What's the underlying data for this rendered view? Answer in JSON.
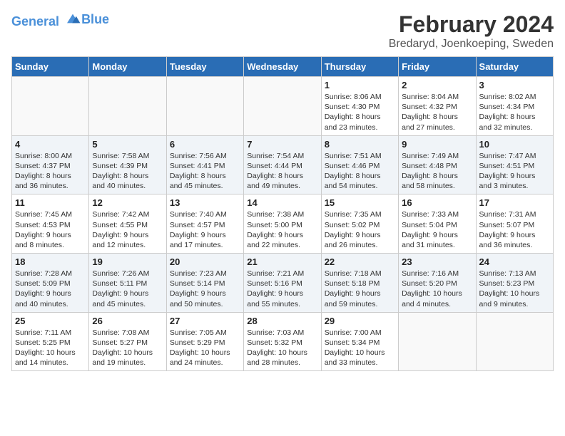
{
  "logo": {
    "line1": "General",
    "line2": "Blue"
  },
  "title": "February 2024",
  "subtitle": "Bredaryd, Joenkoeping, Sweden",
  "headers": [
    "Sunday",
    "Monday",
    "Tuesday",
    "Wednesday",
    "Thursday",
    "Friday",
    "Saturday"
  ],
  "weeks": [
    [
      {
        "day": "",
        "info": ""
      },
      {
        "day": "",
        "info": ""
      },
      {
        "day": "",
        "info": ""
      },
      {
        "day": "",
        "info": ""
      },
      {
        "day": "1",
        "info": "Sunrise: 8:06 AM\nSunset: 4:30 PM\nDaylight: 8 hours\nand 23 minutes."
      },
      {
        "day": "2",
        "info": "Sunrise: 8:04 AM\nSunset: 4:32 PM\nDaylight: 8 hours\nand 27 minutes."
      },
      {
        "day": "3",
        "info": "Sunrise: 8:02 AM\nSunset: 4:34 PM\nDaylight: 8 hours\nand 32 minutes."
      }
    ],
    [
      {
        "day": "4",
        "info": "Sunrise: 8:00 AM\nSunset: 4:37 PM\nDaylight: 8 hours\nand 36 minutes."
      },
      {
        "day": "5",
        "info": "Sunrise: 7:58 AM\nSunset: 4:39 PM\nDaylight: 8 hours\nand 40 minutes."
      },
      {
        "day": "6",
        "info": "Sunrise: 7:56 AM\nSunset: 4:41 PM\nDaylight: 8 hours\nand 45 minutes."
      },
      {
        "day": "7",
        "info": "Sunrise: 7:54 AM\nSunset: 4:44 PM\nDaylight: 8 hours\nand 49 minutes."
      },
      {
        "day": "8",
        "info": "Sunrise: 7:51 AM\nSunset: 4:46 PM\nDaylight: 8 hours\nand 54 minutes."
      },
      {
        "day": "9",
        "info": "Sunrise: 7:49 AM\nSunset: 4:48 PM\nDaylight: 8 hours\nand 58 minutes."
      },
      {
        "day": "10",
        "info": "Sunrise: 7:47 AM\nSunset: 4:51 PM\nDaylight: 9 hours\nand 3 minutes."
      }
    ],
    [
      {
        "day": "11",
        "info": "Sunrise: 7:45 AM\nSunset: 4:53 PM\nDaylight: 9 hours\nand 8 minutes."
      },
      {
        "day": "12",
        "info": "Sunrise: 7:42 AM\nSunset: 4:55 PM\nDaylight: 9 hours\nand 12 minutes."
      },
      {
        "day": "13",
        "info": "Sunrise: 7:40 AM\nSunset: 4:57 PM\nDaylight: 9 hours\nand 17 minutes."
      },
      {
        "day": "14",
        "info": "Sunrise: 7:38 AM\nSunset: 5:00 PM\nDaylight: 9 hours\nand 22 minutes."
      },
      {
        "day": "15",
        "info": "Sunrise: 7:35 AM\nSunset: 5:02 PM\nDaylight: 9 hours\nand 26 minutes."
      },
      {
        "day": "16",
        "info": "Sunrise: 7:33 AM\nSunset: 5:04 PM\nDaylight: 9 hours\nand 31 minutes."
      },
      {
        "day": "17",
        "info": "Sunrise: 7:31 AM\nSunset: 5:07 PM\nDaylight: 9 hours\nand 36 minutes."
      }
    ],
    [
      {
        "day": "18",
        "info": "Sunrise: 7:28 AM\nSunset: 5:09 PM\nDaylight: 9 hours\nand 40 minutes."
      },
      {
        "day": "19",
        "info": "Sunrise: 7:26 AM\nSunset: 5:11 PM\nDaylight: 9 hours\nand 45 minutes."
      },
      {
        "day": "20",
        "info": "Sunrise: 7:23 AM\nSunset: 5:14 PM\nDaylight: 9 hours\nand 50 minutes."
      },
      {
        "day": "21",
        "info": "Sunrise: 7:21 AM\nSunset: 5:16 PM\nDaylight: 9 hours\nand 55 minutes."
      },
      {
        "day": "22",
        "info": "Sunrise: 7:18 AM\nSunset: 5:18 PM\nDaylight: 9 hours\nand 59 minutes."
      },
      {
        "day": "23",
        "info": "Sunrise: 7:16 AM\nSunset: 5:20 PM\nDaylight: 10 hours\nand 4 minutes."
      },
      {
        "day": "24",
        "info": "Sunrise: 7:13 AM\nSunset: 5:23 PM\nDaylight: 10 hours\nand 9 minutes."
      }
    ],
    [
      {
        "day": "25",
        "info": "Sunrise: 7:11 AM\nSunset: 5:25 PM\nDaylight: 10 hours\nand 14 minutes."
      },
      {
        "day": "26",
        "info": "Sunrise: 7:08 AM\nSunset: 5:27 PM\nDaylight: 10 hours\nand 19 minutes."
      },
      {
        "day": "27",
        "info": "Sunrise: 7:05 AM\nSunset: 5:29 PM\nDaylight: 10 hours\nand 24 minutes."
      },
      {
        "day": "28",
        "info": "Sunrise: 7:03 AM\nSunset: 5:32 PM\nDaylight: 10 hours\nand 28 minutes."
      },
      {
        "day": "29",
        "info": "Sunrise: 7:00 AM\nSunset: 5:34 PM\nDaylight: 10 hours\nand 33 minutes."
      },
      {
        "day": "",
        "info": ""
      },
      {
        "day": "",
        "info": ""
      }
    ]
  ]
}
